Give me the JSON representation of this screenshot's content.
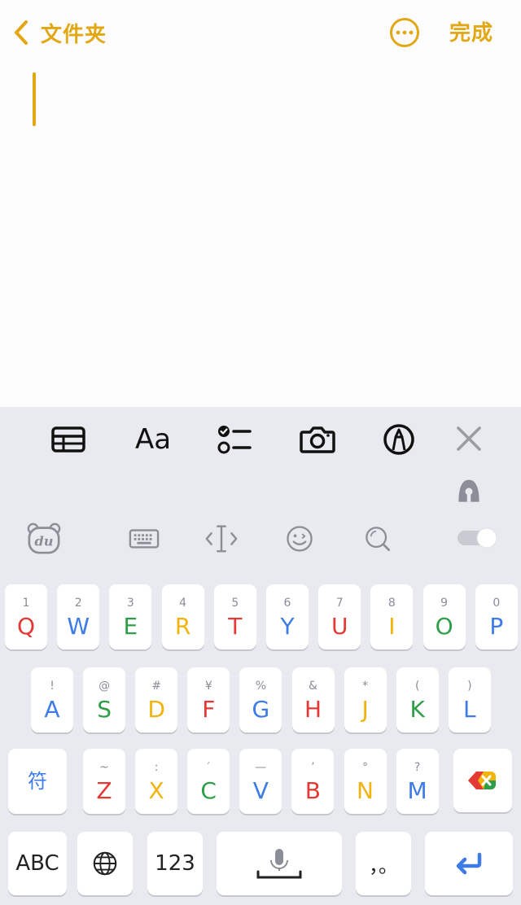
{
  "header": {
    "back_label": "文件夹",
    "more_icon": "more-circle-icon",
    "done_label": "完成"
  },
  "colors": {
    "accent": "#e2a814",
    "key_red": "#e53935",
    "key_blue": "#3c7be8",
    "key_green": "#2f9e48",
    "key_yellow": "#f1b30c"
  },
  "toolbar": {
    "items": [
      {
        "icon": "table-icon"
      },
      {
        "label": "Aa",
        "icon": "text-format-icon"
      },
      {
        "icon": "checklist-icon"
      },
      {
        "icon": "camera-icon"
      },
      {
        "icon": "markup-pen-icon"
      },
      {
        "icon": "close-icon"
      }
    ]
  },
  "ime_bar": {
    "items": [
      "du-logo-icon",
      "keyboard-icon",
      "cursor-move-icon",
      "emoji-icon",
      "search-icon",
      "toggle-switch"
    ],
    "top_right_icon": "assistant-icon"
  },
  "keyboard": {
    "row1": [
      {
        "main": "Q",
        "sub": "1",
        "color": "red"
      },
      {
        "main": "W",
        "sub": "2",
        "color": "blue"
      },
      {
        "main": "E",
        "sub": "3",
        "color": "green"
      },
      {
        "main": "R",
        "sub": "4",
        "color": "yellow"
      },
      {
        "main": "T",
        "sub": "5",
        "color": "red"
      },
      {
        "main": "Y",
        "sub": "6",
        "color": "blue"
      },
      {
        "main": "U",
        "sub": "7",
        "color": "red"
      },
      {
        "main": "I",
        "sub": "8",
        "color": "yellow"
      },
      {
        "main": "O",
        "sub": "9",
        "color": "green"
      },
      {
        "main": "P",
        "sub": "0",
        "color": "blue"
      }
    ],
    "row2": [
      {
        "main": "A",
        "sub": "!",
        "color": "blue"
      },
      {
        "main": "S",
        "sub": "@",
        "color": "green"
      },
      {
        "main": "D",
        "sub": "#",
        "color": "yellow"
      },
      {
        "main": "F",
        "sub": "¥",
        "color": "red"
      },
      {
        "main": "G",
        "sub": "%",
        "color": "blue"
      },
      {
        "main": "H",
        "sub": "&",
        "color": "red"
      },
      {
        "main": "J",
        "sub": "*",
        "color": "yellow"
      },
      {
        "main": "K",
        "sub": "(",
        "color": "green"
      },
      {
        "main": "L",
        "sub": ")",
        "color": "blue"
      }
    ],
    "row3": [
      {
        "main": "符",
        "sub": "",
        "color": "blue"
      },
      {
        "main": "Z",
        "sub": "~",
        "color": "red"
      },
      {
        "main": "X",
        "sub": ":",
        "color": "yellow"
      },
      {
        "main": "C",
        "sub": "′",
        "color": "green"
      },
      {
        "main": "V",
        "sub": "—",
        "color": "blue"
      },
      {
        "main": "B",
        "sub": "’",
        "color": "red"
      },
      {
        "main": "N",
        "sub": "°",
        "color": "yellow"
      },
      {
        "main": "M",
        "sub": "?",
        "color": "blue"
      }
    ],
    "row4": {
      "abc": "ABC",
      "globe_icon": "globe-icon",
      "num": "123",
      "space_icon": "microphone-icon",
      "punct": "，。",
      "enter_icon": "return-icon"
    },
    "delete_icon": "delete-icon"
  }
}
